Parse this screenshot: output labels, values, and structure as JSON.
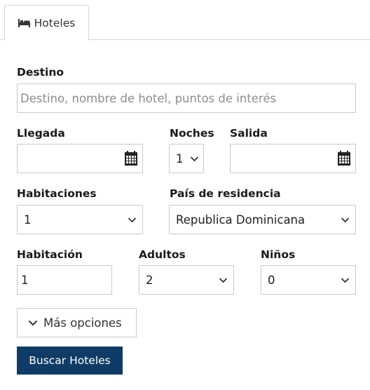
{
  "tab": {
    "label": "Hoteles",
    "icon": "bed-icon"
  },
  "form": {
    "destination": {
      "label": "Destino",
      "placeholder": "Destino, nombre de hotel, puntos de interés",
      "value": ""
    },
    "checkin": {
      "label": "Llegada",
      "value": "",
      "icon": "calendar-icon"
    },
    "nights": {
      "label": "Noches",
      "value": "1"
    },
    "checkout": {
      "label": "Salida",
      "value": "",
      "icon": "calendar-icon"
    },
    "rooms": {
      "label": "Habitaciones",
      "value": "1"
    },
    "residence": {
      "label": "País de residencia",
      "value": "Republica Dominicana"
    },
    "room": {
      "label": "Habitación",
      "value": "1"
    },
    "adults": {
      "label": "Adultos",
      "value": "2"
    },
    "children": {
      "label": "Niños",
      "value": "0"
    },
    "more_options": {
      "label": "Más opciones",
      "icon": "chevron-down-icon"
    },
    "submit": {
      "label": "Buscar Hoteles"
    }
  },
  "colors": {
    "primary": "#0f3c66",
    "border": "#c9c9c9",
    "placeholder": "#8e8e8e"
  }
}
